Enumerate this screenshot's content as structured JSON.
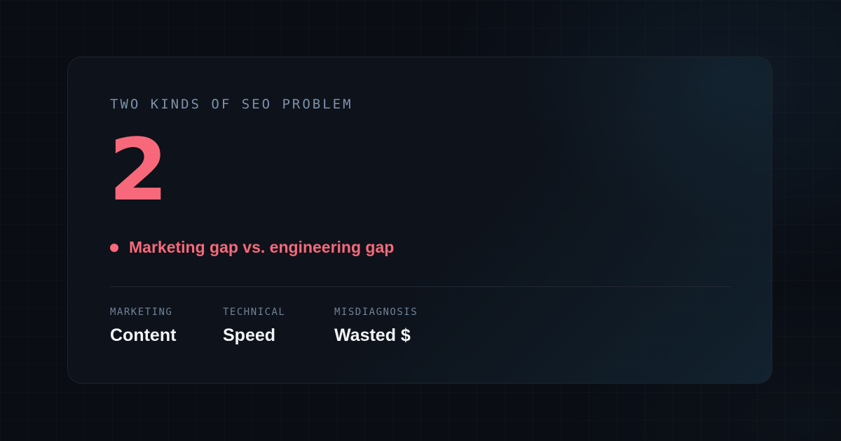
{
  "card": {
    "eyebrow": "TWO KINDS OF SEO PROBLEM",
    "big_number": "2",
    "tagline": "Marketing gap vs. engineering gap",
    "stats": [
      {
        "label": "MARKETING",
        "value": "Content"
      },
      {
        "label": "TECHNICAL",
        "value": "Speed"
      },
      {
        "label": "MISDIAGNOSIS",
        "value": "Wasted $"
      }
    ]
  },
  "colors": {
    "background": "#0a0d14",
    "accent": "#f7697a",
    "eyebrow": "#7d92ab",
    "stat_value": "#f2f4f7"
  }
}
